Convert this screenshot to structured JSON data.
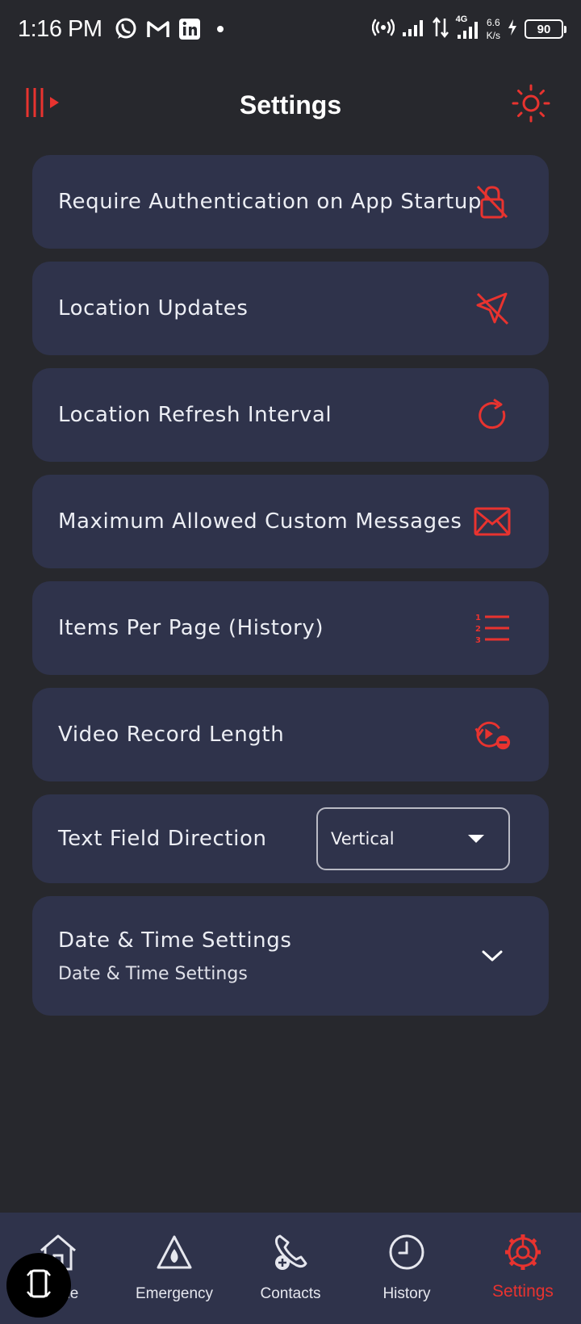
{
  "status_bar": {
    "time": "1:16 PM",
    "net_speed_value": "6.6",
    "net_speed_unit": "K/s",
    "network_type": "4G",
    "battery": "90"
  },
  "header": {
    "title": "Settings"
  },
  "settings": [
    {
      "label": "Require Authentication on App Startup",
      "icon": "lock-off-icon"
    },
    {
      "label": "Location Updates",
      "icon": "navigation-off-icon"
    },
    {
      "label": "Location Refresh Interval",
      "icon": "refresh-icon"
    },
    {
      "label": "Maximum Allowed Custom Messages",
      "icon": "mail-icon"
    },
    {
      "label": "Items Per Page (History)",
      "icon": "numbered-list-icon"
    },
    {
      "label": "Video Record Length",
      "icon": "replay-remove-icon"
    }
  ],
  "text_field_direction": {
    "label": "Text Field Direction",
    "selected": "Vertical"
  },
  "date_time": {
    "title": "Date & Time Settings",
    "subtitle": "Date & Time Settings"
  },
  "bottom_nav": [
    {
      "label": "Home",
      "icon": "home-icon"
    },
    {
      "label": "Emergency",
      "icon": "emergency-icon"
    },
    {
      "label": "Contacts",
      "icon": "add-contact-icon"
    },
    {
      "label": "History",
      "icon": "clock-icon"
    },
    {
      "label": "Settings",
      "icon": "gear-icon"
    }
  ],
  "colors": {
    "accent": "#e8332f",
    "background": "#27282d",
    "card": "#2f334b"
  }
}
